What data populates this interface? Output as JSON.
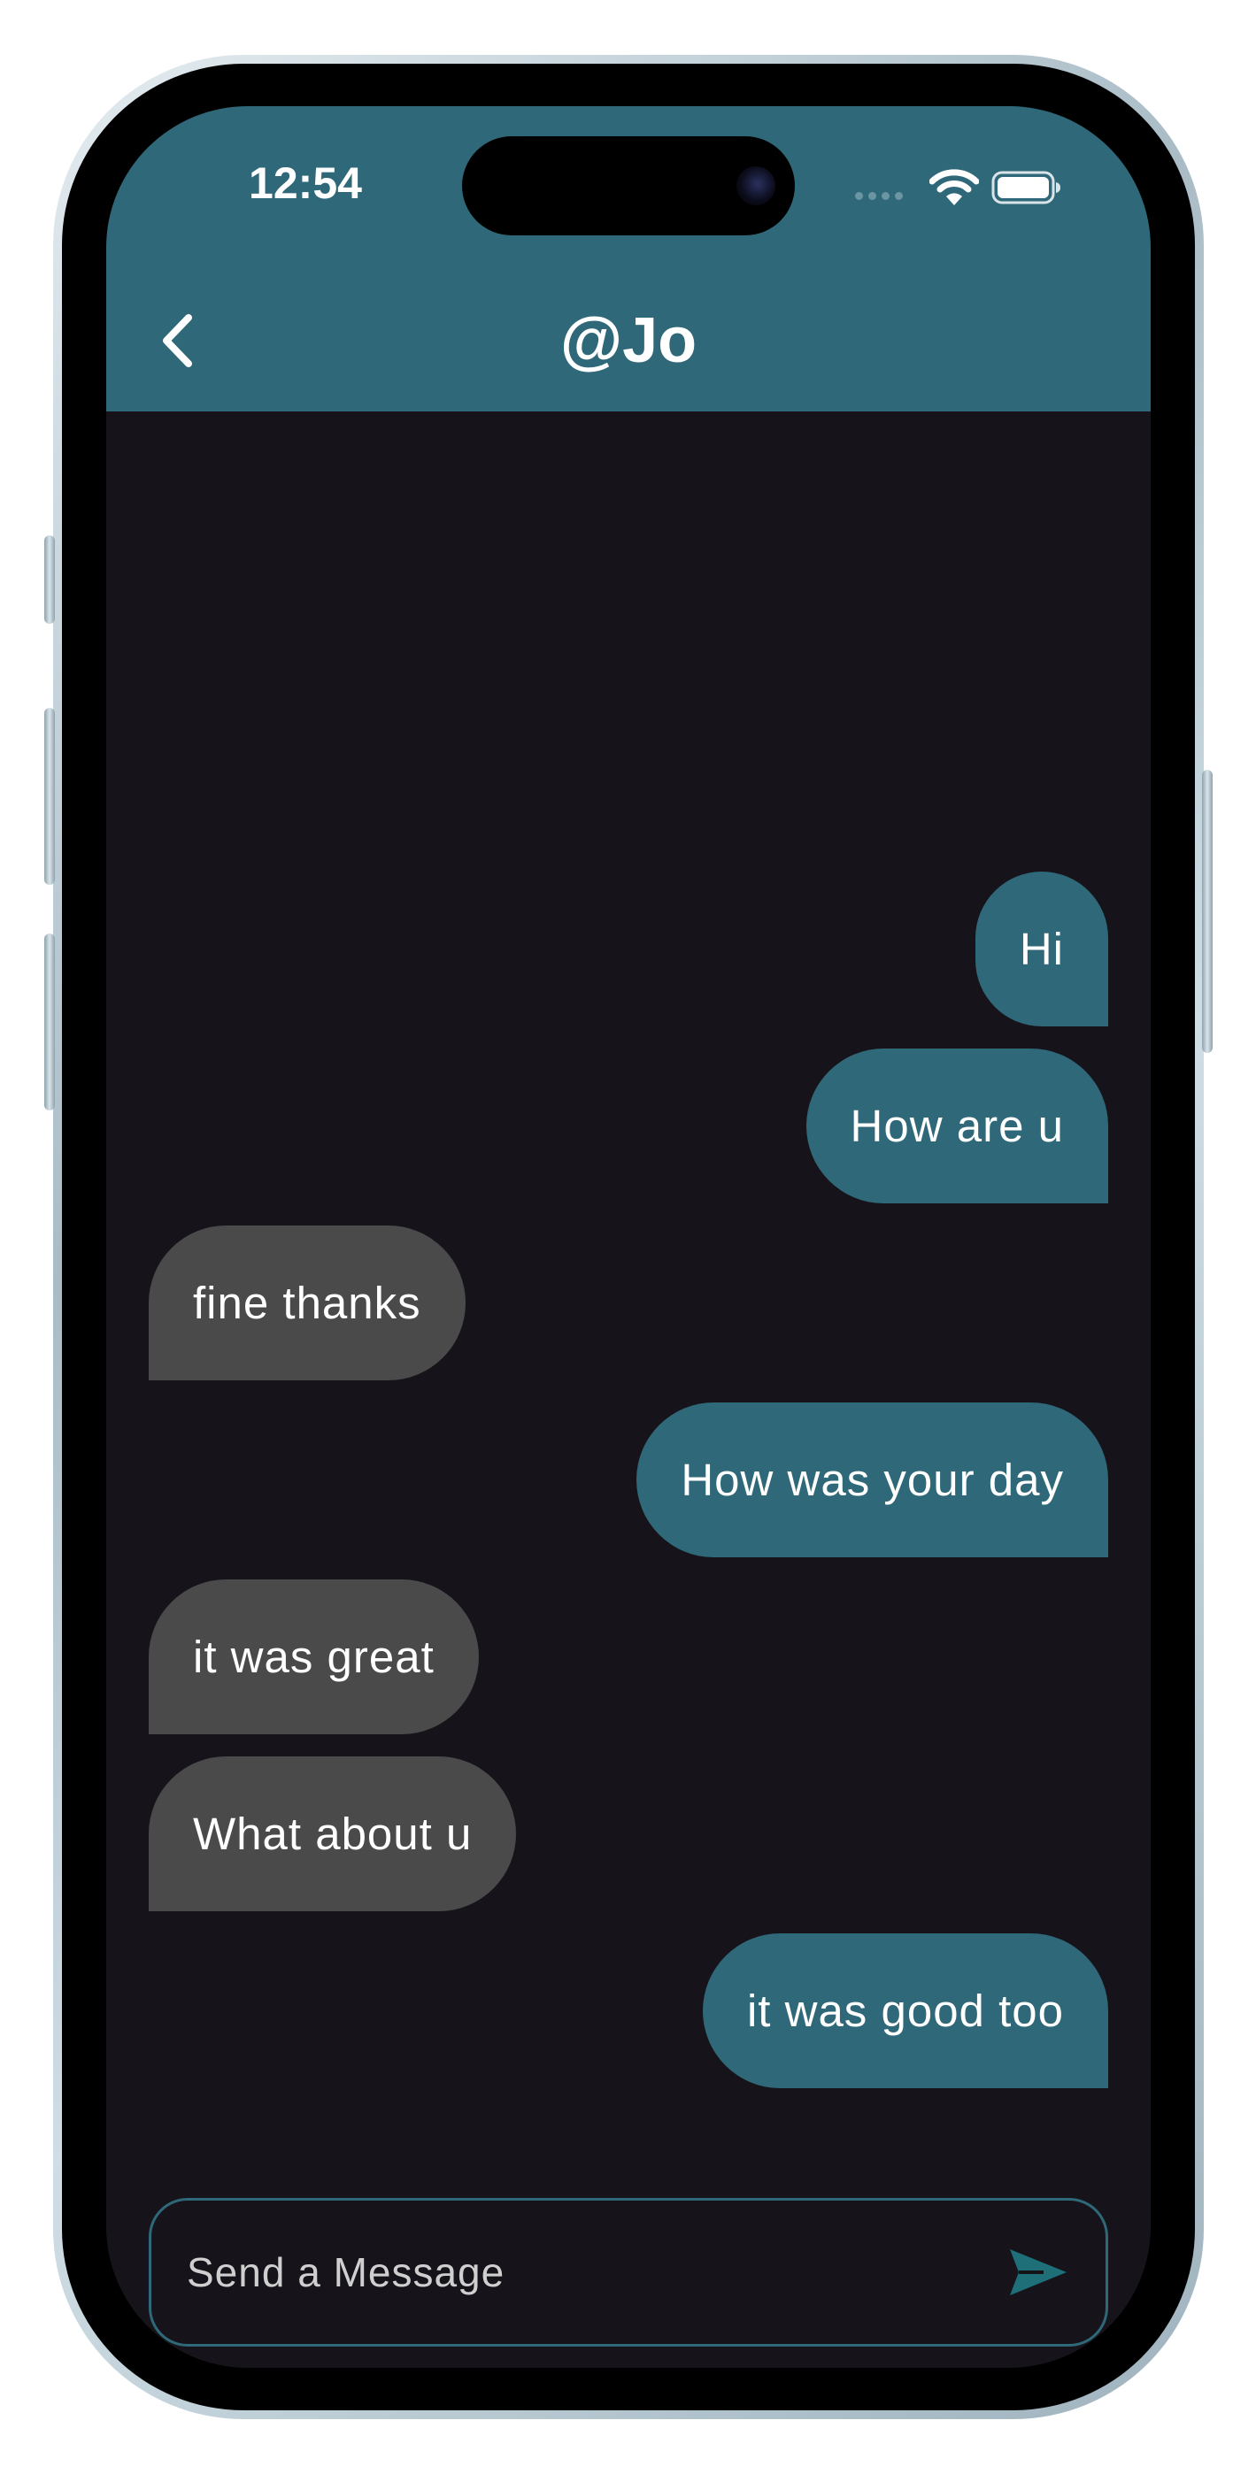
{
  "status_bar": {
    "time": "12:54",
    "icons": [
      "signal-icon",
      "wifi-icon",
      "battery-icon"
    ]
  },
  "header": {
    "title": "@Jo",
    "back_icon": "chevron-left-icon",
    "background_color": "#2f6878"
  },
  "messages": [
    {
      "text": "Hi",
      "sender": "me"
    },
    {
      "text": "How are u",
      "sender": "me"
    },
    {
      "text": "fine thanks",
      "sender": "other"
    },
    {
      "text": "How was your day",
      "sender": "me"
    },
    {
      "text": "it was great",
      "sender": "other"
    },
    {
      "text": "What about u",
      "sender": "other"
    },
    {
      "text": "it was good too",
      "sender": "me"
    }
  ],
  "composer": {
    "placeholder": "Send a Message",
    "value": "",
    "send_icon": "send-icon"
  },
  "colors": {
    "sent_bubble": "#2f6878",
    "received_bubble": "#4a4a4a",
    "chat_background": "#16141a",
    "send_icon": "#1f6f78"
  }
}
